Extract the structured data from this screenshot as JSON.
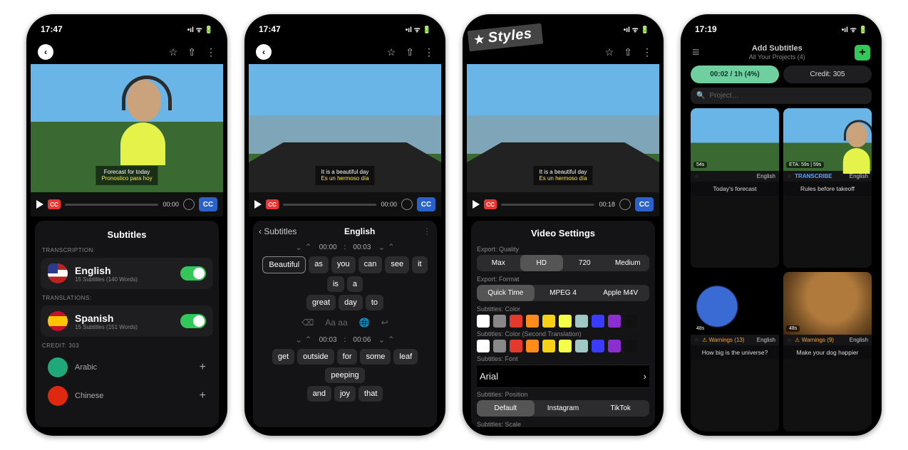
{
  "status": {
    "t1": "17:47",
    "t4": "17:19",
    "icons": "􀙇 􀛨"
  },
  "toolbar": {
    "back": "‹",
    "star": "☆",
    "share": "⇪",
    "more": "⋮"
  },
  "subtitle_line1_a": "Forecast for today",
  "subtitle_line2_a": "Pronostico para hoy",
  "subtitle_line1_b": "It is a beautiful day",
  "subtitle_line2_b": "Es un hermoso día",
  "transport": {
    "time0": "00:00",
    "time18": "00:18",
    "cc": "CC"
  },
  "s1": {
    "title": "Subtitles",
    "h1": "TRANSCRIPTION:",
    "en": "English",
    "en_meta": "15 Subtitles (140 Words)",
    "h2": "TRANSLATIONS:",
    "es": "Spanish",
    "es_meta": "15 Subtitles (151 Words)",
    "credit": "CREDIT: 303",
    "ar": "Arabic",
    "cn": "Chinese"
  },
  "s2": {
    "back": "Subtitles",
    "title": "English",
    "t0a": "00:00",
    "t0b": "00:03",
    "row1": [
      "Beautiful",
      "as",
      "you",
      "can",
      "see",
      "it",
      "is",
      "a"
    ],
    "row1b": [
      "great",
      "day",
      "to"
    ],
    "actions": [
      "⌫",
      "Aa aa",
      "🌐",
      "↩︎"
    ],
    "t1a": "00:03",
    "t1b": "00:06",
    "row2": [
      "get",
      "outside",
      "for",
      "some",
      "leaf",
      "peeping"
    ],
    "row2b": [
      "and",
      "joy",
      "that"
    ]
  },
  "s3": {
    "tag": "Styles",
    "title": "Video Settings",
    "h_qual": "Export: Quality",
    "qual": [
      "Max",
      "HD",
      "720",
      "Medium"
    ],
    "qual_on": 1,
    "h_fmt": "Export: Format",
    "fmt": [
      "Quick Time",
      "MPEG 4",
      "Apple M4V"
    ],
    "fmt_on": 0,
    "h_c1": "Subtitles: Color",
    "colors": [
      "#ffffff",
      "#888888",
      "#e23b2e",
      "#ff8c1a",
      "#f6d116",
      "#f4ff4a",
      "#9fc7c4",
      "#3b3bff",
      "#8b2fd0",
      "#111111"
    ],
    "h_c2": "Subtitles: Color (Second Translation)",
    "h_font": "Subtitles: Font",
    "font": "Arial",
    "h_pos": "Subtitles: Position",
    "pos": [
      "Default",
      "Instagram",
      "TikTok"
    ],
    "pos_on": 0,
    "h_scale": "Subtitles: Scale"
  },
  "s4": {
    "title": "Add Subtitles",
    "sub": "All Your Projects (4)",
    "pill1": "00:02 / 1h (4%)",
    "pill2": "Credit: 305",
    "search": "Project…",
    "cards": [
      {
        "dur": "54s",
        "lang": "English",
        "title": "Today's forecast"
      },
      {
        "dur": "ETA: 59s | 59s",
        "badge": "TRANSCRIBE",
        "lang": "English",
        "title": "Rules before takeoff"
      },
      {
        "dur": "48s",
        "warn": "Warnings  (13)",
        "lang": "English",
        "title": "How big is the universe?"
      },
      {
        "dur": "48s",
        "warn": "Warnings  (9)",
        "lang": "English",
        "title": "Make your dog happier"
      }
    ]
  }
}
